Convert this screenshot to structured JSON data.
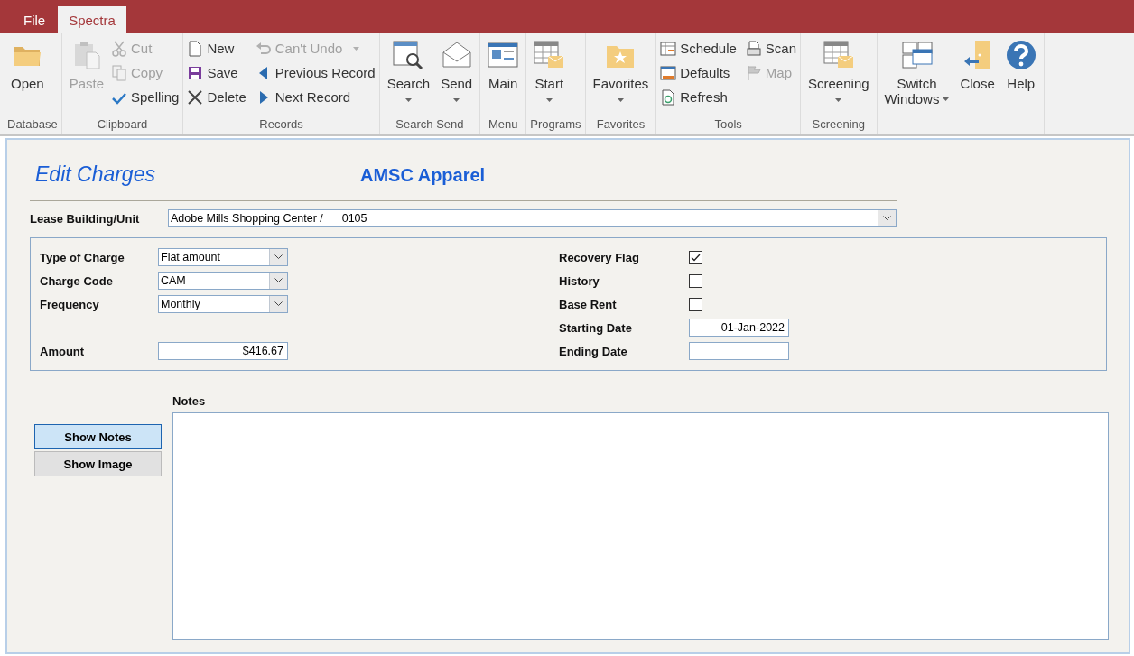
{
  "ribbon": {
    "tabs": [
      {
        "label": "File",
        "selected": false
      },
      {
        "label": "Spectra",
        "selected": true
      }
    ],
    "groups": [
      {
        "label": "Database",
        "items": [
          {
            "kind": "large",
            "label": "Open",
            "disabled": false
          }
        ]
      },
      {
        "label": "Clipboard",
        "items": [
          {
            "kind": "large",
            "label": "Paste",
            "disabled": true
          },
          {
            "kind": "small",
            "label": "Cut",
            "disabled": true
          },
          {
            "kind": "small",
            "label": "Copy",
            "disabled": true
          },
          {
            "kind": "small",
            "label": "Spelling",
            "disabled": false
          }
        ]
      },
      {
        "label": "Records",
        "items": [
          {
            "kind": "small",
            "label": "New",
            "disabled": false
          },
          {
            "kind": "small",
            "label": "Save",
            "disabled": false
          },
          {
            "kind": "small",
            "label": "Delete",
            "disabled": false
          },
          {
            "kind": "small",
            "label": "Can't Undo",
            "disabled": true,
            "dropdown": true
          },
          {
            "kind": "small",
            "label": "Previous Record",
            "disabled": false
          },
          {
            "kind": "small",
            "label": "Next Record",
            "disabled": false
          }
        ]
      },
      {
        "label": "Search Send",
        "items": [
          {
            "kind": "large",
            "label": "Search",
            "disabled": false,
            "dropdown": true
          },
          {
            "kind": "large",
            "label": "Send",
            "disabled": false,
            "dropdown": true
          }
        ]
      },
      {
        "label": "Menu",
        "items": [
          {
            "kind": "large",
            "label": "Main",
            "disabled": false
          }
        ]
      },
      {
        "label": "Programs",
        "items": [
          {
            "kind": "large",
            "label": "Start",
            "disabled": false,
            "dropdown": true
          }
        ]
      },
      {
        "label": "Favorites",
        "items": [
          {
            "kind": "large",
            "label": "Favorites",
            "disabled": false,
            "dropdown": true
          }
        ]
      },
      {
        "label": "Tools",
        "items": [
          {
            "kind": "small",
            "label": "Schedule",
            "disabled": false
          },
          {
            "kind": "small",
            "label": "Defaults",
            "disabled": false
          },
          {
            "kind": "small",
            "label": "Refresh",
            "disabled": false
          },
          {
            "kind": "small",
            "label": "Scan",
            "disabled": false
          },
          {
            "kind": "small",
            "label": "Map",
            "disabled": true
          }
        ]
      },
      {
        "label": "Screening",
        "items": [
          {
            "kind": "large",
            "label": "Screening",
            "disabled": false,
            "dropdown": true
          }
        ]
      },
      {
        "items": [
          {
            "kind": "large",
            "label": "Switch Windows",
            "disabled": false,
            "dropdown": true
          },
          {
            "kind": "large",
            "label": "Close",
            "disabled": false
          },
          {
            "kind": "large",
            "label": "Help",
            "disabled": false
          }
        ]
      }
    ]
  },
  "form": {
    "title": "Edit Charges",
    "subtitle": "AMSC Apparel",
    "lease": {
      "label": "Lease Building/Unit",
      "value": "Adobe Mills Shopping Center /      0105"
    },
    "fields_left": [
      {
        "kind": "combo",
        "label": "Type of Charge",
        "value": "Flat amount"
      },
      {
        "kind": "combo",
        "label": "Charge Code",
        "value": "CAM"
      },
      {
        "kind": "combo",
        "label": "Frequency",
        "value": "Monthly"
      },
      {
        "kind": "text",
        "label": "Amount",
        "value": "$416.67"
      }
    ],
    "fields_right": [
      {
        "kind": "checkbox",
        "label": "Recovery Flag",
        "checked": true
      },
      {
        "kind": "checkbox",
        "label": "History",
        "checked": false
      },
      {
        "kind": "checkbox",
        "label": "Base Rent",
        "checked": false
      },
      {
        "kind": "date",
        "label": "Starting Date",
        "value": "01-Jan-2022"
      },
      {
        "kind": "date",
        "label": "Ending Date"
      }
    ],
    "view_buttons": [
      {
        "label": "Show Notes",
        "selected": true
      },
      {
        "label": "Show Image",
        "selected": false
      }
    ],
    "notes": {
      "label": "Notes"
    }
  }
}
